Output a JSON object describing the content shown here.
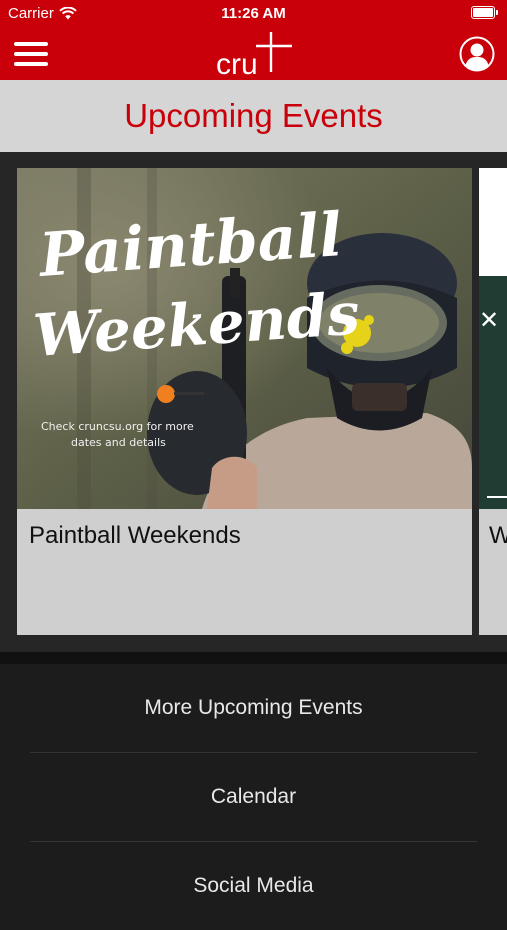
{
  "status_bar": {
    "carrier": "Carrier",
    "time": "11:26 AM"
  },
  "nav": {
    "logo_text": "cru",
    "brand_color": "#c9000a"
  },
  "header": {
    "title": "Upcoming Events"
  },
  "events": [
    {
      "title": "Paintball Weekends",
      "image": {
        "headline_line1": "Paintball",
        "headline_line2": "Weekends",
        "caption_line1": "Check cruncsu.org for more",
        "caption_line2": "dates and details"
      }
    },
    {
      "title_partial": "W"
    }
  ],
  "links": [
    {
      "label": "More Upcoming Events"
    },
    {
      "label": "Calendar"
    },
    {
      "label": "Social Media"
    }
  ],
  "icons": {
    "menu": "hamburger-menu-icon",
    "profile": "user-profile-icon",
    "wifi": "wifi-icon",
    "battery": "battery-icon"
  }
}
